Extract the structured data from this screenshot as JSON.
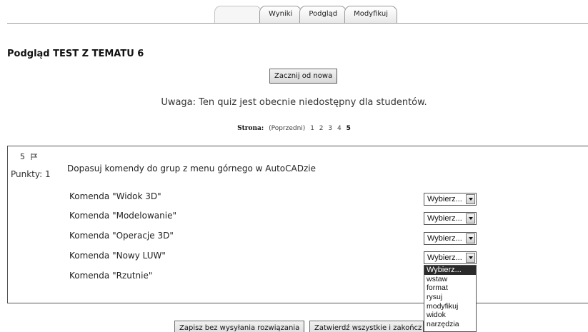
{
  "tabs": [
    {
      "label": "",
      "disabled": true
    },
    {
      "label": "Wyniki"
    },
    {
      "label": "Podgląd"
    },
    {
      "label": "Modyfikuj"
    }
  ],
  "page_title": "Podgląd TEST Z TEMATU 6",
  "restart_button": "Zacznij od nowa",
  "notice": "Uwaga: Ten quiz jest obecnie niedostępny dla studentów.",
  "pager": {
    "label": "Strona:",
    "prev": "(Poprzedni)",
    "pages": [
      "1",
      "2",
      "3",
      "4",
      "5"
    ],
    "current": "5"
  },
  "question": {
    "number": "5",
    "points": "Punkty: 1",
    "text": "Dopasuj komendy do grup z menu górnego w AutoCADzie",
    "rows": [
      {
        "label": "Komenda \"Widok 3D\"",
        "selected": "Wybierz..."
      },
      {
        "label": "Komenda \"Modelowanie\"",
        "selected": "Wybierz..."
      },
      {
        "label": "Komenda \"Operacje 3D\"",
        "selected": "Wybierz..."
      },
      {
        "label": "Komenda \"Nowy LUW\"",
        "selected": "Wybierz..."
      },
      {
        "label": "Komenda \"Rzutnie\"",
        "selected": ""
      }
    ],
    "dropdown_options": [
      "Wybierz...",
      "wstaw",
      "format",
      "rysuj",
      "modyfikuj",
      "widok",
      "narzędzia"
    ]
  },
  "footer": {
    "save_button": "Zapisz bez wysyłania rozwiązania",
    "submit_button": "Zatwierdź wszystkie i zakończ"
  }
}
